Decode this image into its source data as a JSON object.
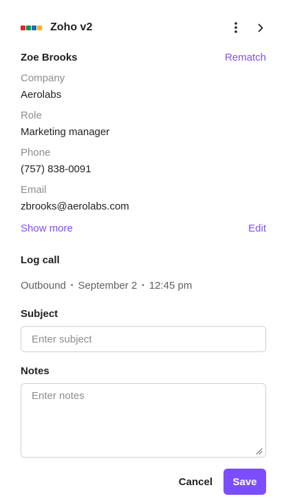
{
  "header": {
    "app_name": "Zoho v2",
    "logo_icon": "zoho-logo",
    "logo_colors": [
      "#e42527",
      "#089949",
      "#226db4",
      "#f9b21d"
    ],
    "more_icon": "vertical-ellipsis-icon",
    "next_icon": "chevron-right-icon"
  },
  "contact": {
    "name": "Zoe Brooks",
    "rematch_label": "Rematch",
    "fields": [
      {
        "label": "Company",
        "value": "Aerolabs"
      },
      {
        "label": "Role",
        "value": "Marketing manager"
      },
      {
        "label": "Phone",
        "value": "(757) 838-0091"
      },
      {
        "label": "Email",
        "value": "zbrooks@aerolabs.com"
      }
    ],
    "show_more_label": "Show more",
    "edit_label": "Edit"
  },
  "log_call": {
    "title": "Log call",
    "direction": "Outbound",
    "date": "September 2",
    "time": "12:45 pm",
    "subject_label": "Subject",
    "subject_placeholder": "Enter subject",
    "notes_label": "Notes",
    "notes_placeholder": "Enter notes",
    "cancel_label": "Cancel",
    "save_label": "Save"
  },
  "colors": {
    "accent": "#7c4dff",
    "text": "#1f1f24",
    "muted": "#8b8b93",
    "border": "#cfcfd4"
  }
}
